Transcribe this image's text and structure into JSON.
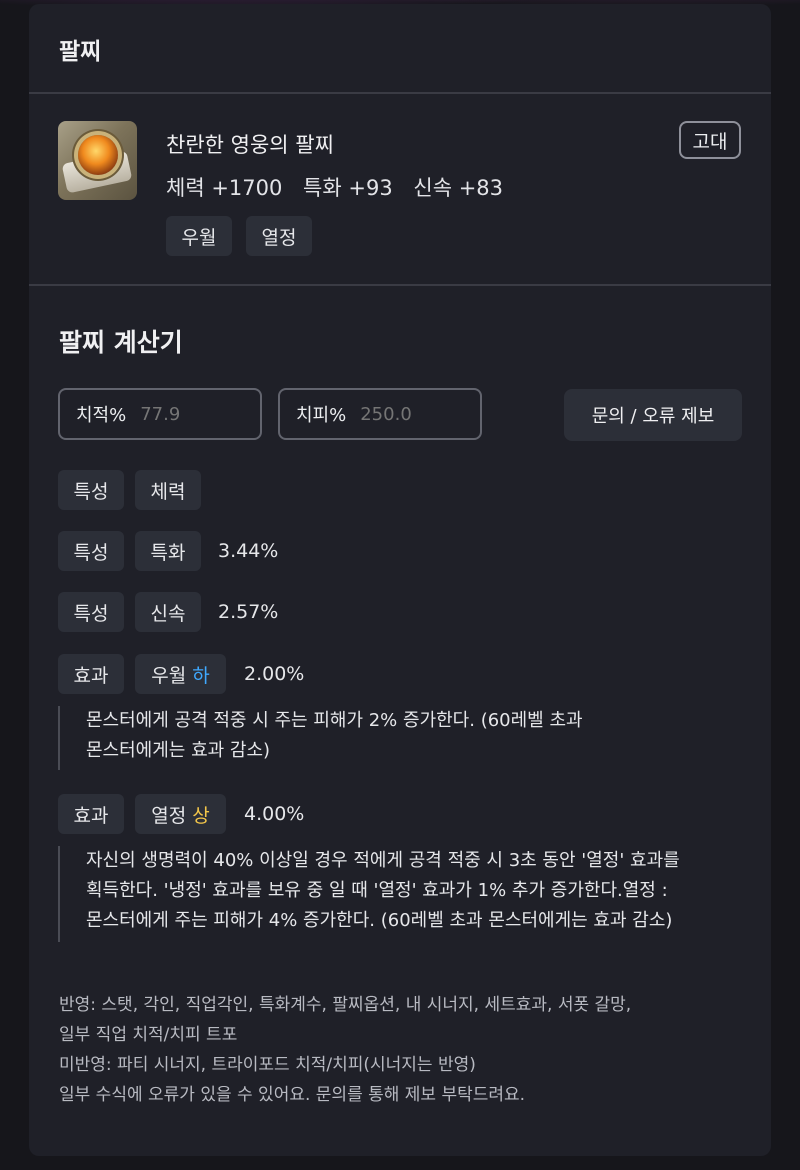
{
  "header": {
    "title": "팔찌"
  },
  "item": {
    "name": "찬란한 영웅의 팔찌",
    "grade": "고대",
    "stats": [
      "체력 +1700",
      "특화 +93",
      "신속 +83"
    ],
    "tags": [
      "우월",
      "열정"
    ]
  },
  "calculator": {
    "title": "팔찌 계산기",
    "crit_label": "치적%",
    "crit_value": "77.9",
    "critdmg_label": "치피%",
    "critdmg_value": "250.0",
    "report_button": "문의 / 오류 제보"
  },
  "rows": [
    {
      "type": "특성",
      "name": "체력",
      "value": ""
    },
    {
      "type": "특성",
      "name": "특화",
      "value": "3.44%"
    },
    {
      "type": "특성",
      "name": "신속",
      "value": "2.57%"
    },
    {
      "type": "효과",
      "name": "우월",
      "grade": "하",
      "value": "2.00%",
      "desc": [
        "몬스터에게 공격 적중 시 주는 피해가 2% 증가한다. (60레벨 초과",
        "몬스터에게는 효과 감소)"
      ]
    },
    {
      "type": "효과",
      "name": "열정",
      "grade": "상",
      "value": "4.00%",
      "desc": [
        "자신의 생명력이 40% 이상일 경우 적에게 공격 적중 시 3초 동안 '열정' 효과를",
        "획득한다. '냉정' 효과를 보유 중 일 때 '열정' 효과가 1% 추가 증가한다.열정 :",
        "몬스터에게 주는 피해가 4% 증가한다. (60레벨 초과 몬스터에게는 효과 감소)"
      ]
    }
  ],
  "footer": [
    "반영: 스탯, 각인, 직업각인, 특화계수, 팔찌옵션, 내 시너지, 세트효과, 서폿 갈망,",
    "일부 직업 치적/치피 트포",
    "미반영: 파티 시너지, 트라이포드 치적/치피(시너지는 반영)",
    "일부 수식에 오류가 있을 수 있어요. 문의를 통해 제보 부탁드려요."
  ],
  "colors": {
    "grade_low": "#3fa9ff",
    "grade_high": "#f3c64a",
    "card_bg": "#1f2028"
  }
}
